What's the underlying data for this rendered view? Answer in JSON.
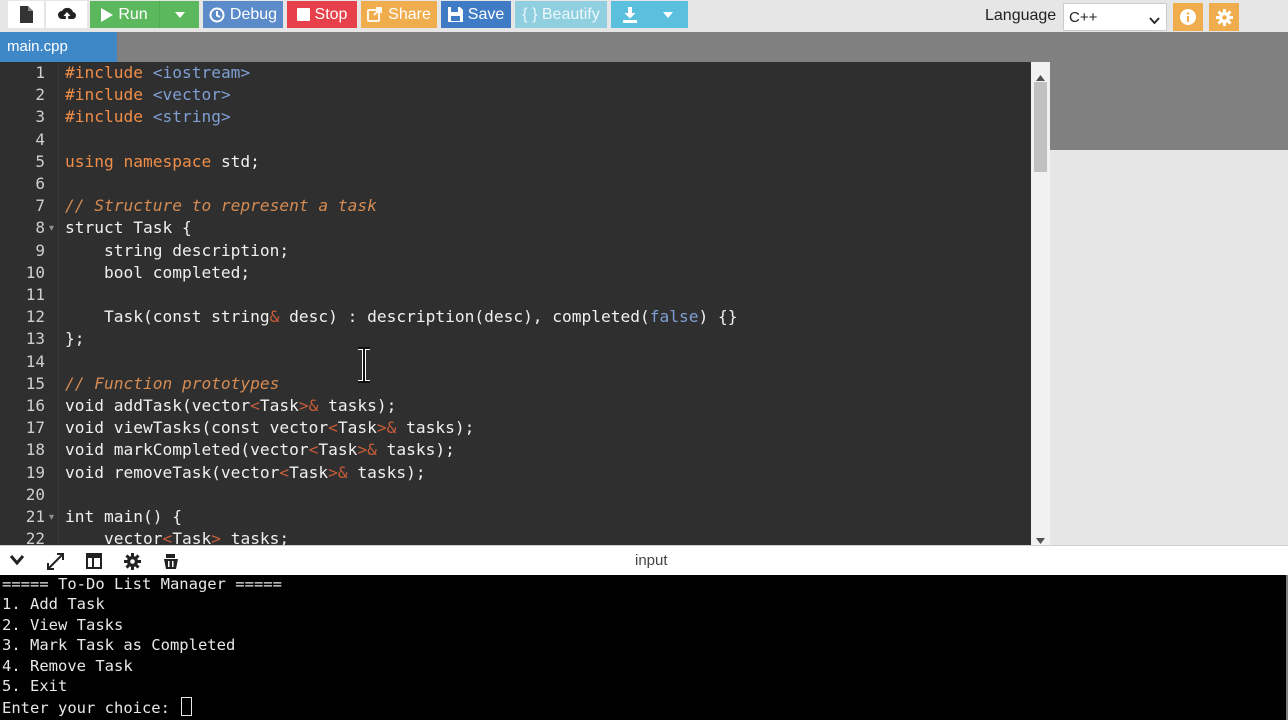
{
  "toolbar": {
    "run_label": "Run",
    "debug_label": "Debug",
    "stop_label": "Stop",
    "share_label": "Share",
    "save_label": "Save",
    "beautify_label": "{ } Beautify",
    "language_label": "Language",
    "language_value": "C++"
  },
  "tabs": [
    {
      "label": "main.cpp"
    }
  ],
  "editor": {
    "lines": [
      {
        "num": "1",
        "fold": "",
        "tokens": [
          {
            "t": "#include ",
            "c": "kw"
          },
          {
            "t": "<iostream>",
            "c": "lit"
          }
        ]
      },
      {
        "num": "2",
        "fold": "",
        "tokens": [
          {
            "t": "#include ",
            "c": "kw"
          },
          {
            "t": "<vector>",
            "c": "lit"
          }
        ]
      },
      {
        "num": "3",
        "fold": "",
        "tokens": [
          {
            "t": "#include ",
            "c": "kw"
          },
          {
            "t": "<string>",
            "c": "lit"
          }
        ]
      },
      {
        "num": "4",
        "fold": "",
        "tokens": []
      },
      {
        "num": "5",
        "fold": "",
        "tokens": [
          {
            "t": "using namespace ",
            "c": "kw"
          },
          {
            "t": "std;",
            "c": ""
          }
        ]
      },
      {
        "num": "6",
        "fold": "",
        "tokens": []
      },
      {
        "num": "7",
        "fold": "",
        "tokens": [
          {
            "t": "// Structure to represent a task",
            "c": "cm"
          }
        ]
      },
      {
        "num": "8",
        "fold": "▾",
        "tokens": [
          {
            "t": "struct Task {",
            "c": ""
          }
        ]
      },
      {
        "num": "9",
        "fold": "",
        "tokens": [
          {
            "t": "    string description;",
            "c": ""
          }
        ]
      },
      {
        "num": "10",
        "fold": "",
        "tokens": [
          {
            "t": "    bool completed;",
            "c": ""
          }
        ]
      },
      {
        "num": "11",
        "fold": "",
        "tokens": []
      },
      {
        "num": "12",
        "fold": "",
        "tokens": [
          {
            "t": "    Task(const string",
            "c": ""
          },
          {
            "t": "&",
            "c": "ang"
          },
          {
            "t": " desc) : description(desc), completed(",
            "c": ""
          },
          {
            "t": "false",
            "c": "lit"
          },
          {
            "t": ") {}",
            "c": ""
          }
        ]
      },
      {
        "num": "13",
        "fold": "",
        "tokens": [
          {
            "t": "};",
            "c": ""
          }
        ]
      },
      {
        "num": "14",
        "fold": "",
        "tokens": []
      },
      {
        "num": "15",
        "fold": "",
        "tokens": [
          {
            "t": "// Function prototypes",
            "c": "cm"
          }
        ]
      },
      {
        "num": "16",
        "fold": "",
        "tokens": [
          {
            "t": "void addTask(vector",
            "c": ""
          },
          {
            "t": "<",
            "c": "ang"
          },
          {
            "t": "Task",
            "c": ""
          },
          {
            "t": ">&",
            "c": "ang"
          },
          {
            "t": " tasks);",
            "c": ""
          }
        ]
      },
      {
        "num": "17",
        "fold": "",
        "tokens": [
          {
            "t": "void viewTasks(const vector",
            "c": ""
          },
          {
            "t": "<",
            "c": "ang"
          },
          {
            "t": "Task",
            "c": ""
          },
          {
            "t": ">&",
            "c": "ang"
          },
          {
            "t": " tasks);",
            "c": ""
          }
        ]
      },
      {
        "num": "18",
        "fold": "",
        "tokens": [
          {
            "t": "void markCompleted(vector",
            "c": ""
          },
          {
            "t": "<",
            "c": "ang"
          },
          {
            "t": "Task",
            "c": ""
          },
          {
            "t": ">&",
            "c": "ang"
          },
          {
            "t": " tasks);",
            "c": ""
          }
        ]
      },
      {
        "num": "19",
        "fold": "",
        "tokens": [
          {
            "t": "void removeTask(vector",
            "c": ""
          },
          {
            "t": "<",
            "c": "ang"
          },
          {
            "t": "Task",
            "c": ""
          },
          {
            "t": ">&",
            "c": "ang"
          },
          {
            "t": " tasks);",
            "c": ""
          }
        ]
      },
      {
        "num": "20",
        "fold": "",
        "tokens": []
      },
      {
        "num": "21",
        "fold": "▾",
        "tokens": [
          {
            "t": "int main() {",
            "c": ""
          }
        ]
      },
      {
        "num": "22",
        "fold": "",
        "tokens": [
          {
            "t": "    vector",
            "c": ""
          },
          {
            "t": "<",
            "c": "ang"
          },
          {
            "t": "Task",
            "c": ""
          },
          {
            "t": ">",
            "c": "ang"
          },
          {
            "t": " tasks;",
            "c": ""
          }
        ]
      }
    ]
  },
  "io": {
    "title": "input",
    "lines": [
      "===== To-Do List Manager =====",
      "1. Add Task",
      "2. View Tasks",
      "3. Mark Task as Completed",
      "4. Remove Task",
      "5. Exit",
      "Enter your choice: "
    ]
  },
  "icons": {
    "file": "file-icon",
    "upload": "upload-icon",
    "run": "play-icon",
    "debug": "debug-icon",
    "stop": "stop-icon",
    "share": "share-icon",
    "save": "floppy-icon",
    "download": "download-icon",
    "info": "info-icon",
    "settings": "gear-icon"
  },
  "colors": {
    "run": "#5cb85c",
    "debug": "#5b8bc9",
    "stop": "#e8404a",
    "share": "#f0ad4e",
    "save": "#3f7cc5",
    "beautify": "#8fcfe0",
    "download": "#5bc0de",
    "tab": "#3f88c8",
    "editor_bg": "#2f2f2f",
    "console_bg": "#000000"
  }
}
